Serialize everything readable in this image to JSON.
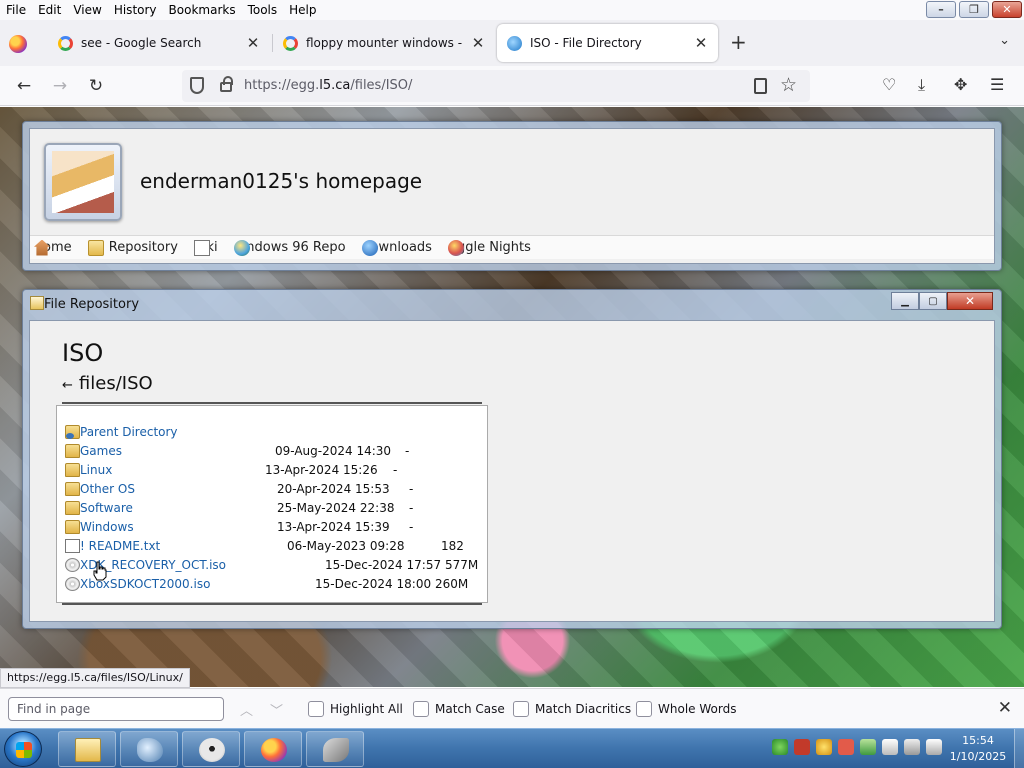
{
  "menubar": {
    "items": [
      "File",
      "Edit",
      "View",
      "History",
      "Bookmarks",
      "Tools",
      "Help"
    ]
  },
  "tabs": [
    {
      "title": "see - Google Search",
      "icon": "google-icon",
      "active": false
    },
    {
      "title": "floppy mounter windows - Goo",
      "icon": "google-icon",
      "active": false
    },
    {
      "title": "ISO - File Directory",
      "icon": "globe-icon",
      "active": true
    }
  ],
  "navbar": {
    "url_prefix": "https://egg.",
    "url_host": "l5.ca",
    "url_path": "/files/ISO/"
  },
  "site": {
    "title": "enderman0125's homepage",
    "nav_links": [
      {
        "label": "ome",
        "icon": "home-icon"
      },
      {
        "label": "e Repository",
        "icon": "folder-icon"
      },
      {
        "label": "iki",
        "icon": "document-icon"
      },
      {
        "label": "indows 96 Repo",
        "icon": "globe-icon"
      },
      {
        "label": "ownloads",
        "icon": "download-icon"
      },
      {
        "label": "ggle Nights",
        "icon": "ball-icon"
      }
    ]
  },
  "repo_window": {
    "title": "File Repository",
    "heading": "ISO",
    "back_arrow": "←",
    "path": "files/ISO"
  },
  "listing": [
    {
      "name": "Parent Directory",
      "date": "",
      "size": "",
      "icon": "parent-folder-icon"
    },
    {
      "name": "Games",
      "date": "09-Aug-2024 14:30",
      "size": "-",
      "icon": "folder-icon"
    },
    {
      "name": "Linux",
      "date": "13-Apr-2024 15:26",
      "size": "-",
      "icon": "folder-icon"
    },
    {
      "name": "Other OS",
      "date": "20-Apr-2024 15:53",
      "size": "-",
      "icon": "folder-icon"
    },
    {
      "name": "Software",
      "date": "25-May-2024 22:38",
      "size": "-",
      "icon": "folder-icon"
    },
    {
      "name": "Windows",
      "date": "13-Apr-2024 15:39",
      "size": "-",
      "icon": "folder-icon"
    },
    {
      "name": "! README.txt",
      "date": "06-May-2023 09:28",
      "size": "182",
      "icon": "text-file-icon"
    },
    {
      "name": "XDK_RECOVERY_OCT.iso",
      "date": "15-Dec-2024 17:57",
      "size": "577M",
      "icon": "disc-icon"
    },
    {
      "name": "XboxSDKOCT2000.iso",
      "date": "15-Dec-2024 18:00",
      "size": "260M",
      "icon": "disc-icon"
    }
  ],
  "status_link": "https://egg.l5.ca/files/ISO/Linux/",
  "findbar": {
    "placeholder": "Find in page",
    "options": [
      "Highlight All",
      "Match Case",
      "Match Diacritics",
      "Whole Words"
    ]
  },
  "taskbar": {
    "time": "15:54",
    "date": "1/10/2025"
  }
}
